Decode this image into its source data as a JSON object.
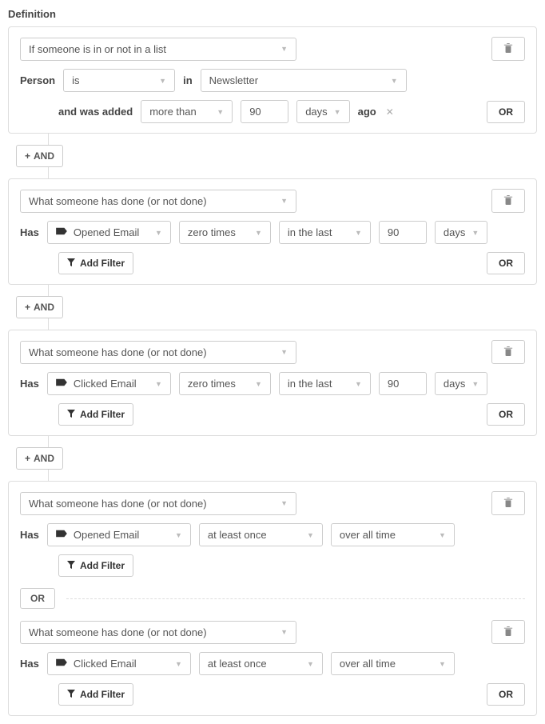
{
  "title": "Definition",
  "and_label": "AND",
  "or_label": "OR",
  "add_filter_label": "Add Filter",
  "ago_label": "ago",
  "block1": {
    "type_select": "If someone is in or not in a list",
    "person": "Person",
    "is": "is",
    "in": "in",
    "list": "Newsletter",
    "added": "and was added",
    "comparator": "more than",
    "value": "90",
    "unit": "days"
  },
  "block2": {
    "type_select": "What someone has done (or not done)",
    "has": "Has",
    "event": "Opened Email",
    "freq": "zero times",
    "range": "in the last",
    "value": "90",
    "unit": "days"
  },
  "block3": {
    "type_select": "What someone has done (or not done)",
    "has": "Has",
    "event": "Clicked Email",
    "freq": "zero times",
    "range": "in the last",
    "value": "90",
    "unit": "days"
  },
  "block4": {
    "type_select_a": "What someone has done (or not done)",
    "has_a": "Has",
    "event_a": "Opened Email",
    "freq_a": "at least once",
    "range_a": "over all time",
    "type_select_b": "What someone has done (or not done)",
    "has_b": "Has",
    "event_b": "Clicked Email",
    "freq_b": "at least once",
    "range_b": "over all time"
  }
}
